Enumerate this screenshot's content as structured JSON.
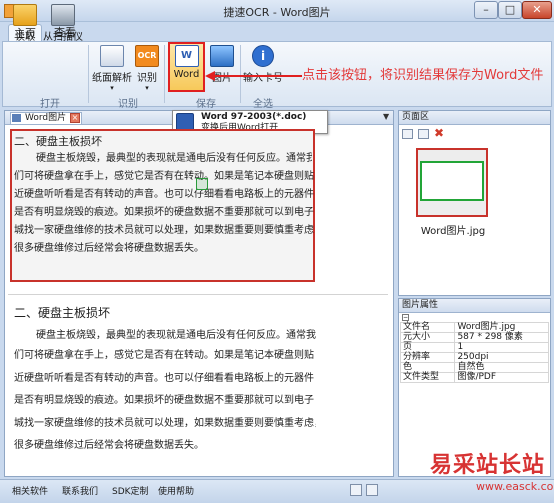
{
  "window": {
    "title": "捷速OCR - Word图片"
  },
  "tabs": [
    {
      "label": "主页"
    },
    {
      "label": "查看"
    }
  ],
  "ribbon": {
    "buttons": [
      {
        "label": "读取"
      },
      {
        "label": "从扫描仪"
      },
      {
        "label": "纸面解析"
      },
      {
        "label": "识别"
      },
      {
        "label": "Word"
      },
      {
        "label": "图片"
      },
      {
        "label": "输入卡号"
      }
    ],
    "groups": [
      {
        "label": "打开"
      },
      {
        "label": "识别"
      },
      {
        "label": "保存"
      },
      {
        "label": "全选"
      }
    ]
  },
  "callout": {
    "text": "点击该按钮，将识别结果保存为Word文件"
  },
  "tooltip": {
    "line1": "Word 97-2003(*.doc)",
    "line2": "变换后用Word打开"
  },
  "document": {
    "tab_label": "Word图片",
    "image": {
      "title": "二、硬盘主板损坏",
      "lines": [
        "硬盘主板烧毁，最典型的表现就是通电后没有任何反应。通常我",
        "们可将硬盘拿在手上，感觉它是否有在转动。如果是笔记本硬盘则贴",
        "近硬盘听听看是否有转动的声音。也可以仔细看看电路板上的元器件",
        "是否有明显烧毁的痕迹。如果损坏的硬盘数据不重要那就可以到电子",
        "城找一家硬盘维修的技术员就可以处理，如果数据重要则要慎重考虑，",
        "很多硬盘维修过后经常会将硬盘数据丢失。"
      ]
    },
    "result": {
      "title": "二、硬盘主板损坏",
      "lines": [
        "硬盘主板烧毁，最典型的表现就是通电后没有任何反应。通常我",
        "们可将硬盘拿在手上，感觉它是否有在转动。如果是笔记本硬盘则贴",
        "近硬盘听听看是否有转动的声音。也可以仔细看看电路板上的元器件",
        "是否有明显烧毁的痕迹。如果损坏的硬盘数据不重要那就可以到电子",
        "城找一家硬盘维修的技术员就可以处理，如果数据重要则要慎重考虑，",
        "很多硬盘维修过后经常会将硬盘数据丢失。"
      ]
    }
  },
  "page_pane": {
    "title": "页面区",
    "thumb_label": "Word图片.jpg"
  },
  "prop_pane": {
    "title": "图片属性",
    "rows": [
      {
        "key": "文件名",
        "value": "Word图片.jpg"
      },
      {
        "key": "元大小",
        "value": "587 * 298 像素"
      },
      {
        "key": "页",
        "value": "1"
      },
      {
        "key": "分辨率",
        "value": "250dpi"
      },
      {
        "key": "色",
        "value": "自然色"
      },
      {
        "key": "文件类型",
        "value": "图像/PDF"
      }
    ]
  },
  "statusbar": {
    "links": [
      "相关软件",
      "联系我们",
      "SDK定制",
      "使用帮助"
    ]
  },
  "watermark": {
    "text": "易采站长站",
    "url": "www.easck.com"
  },
  "colors": {
    "highlight": "#e02020",
    "callout": "#e33a3a",
    "ribbon": "#dbe6f3"
  }
}
